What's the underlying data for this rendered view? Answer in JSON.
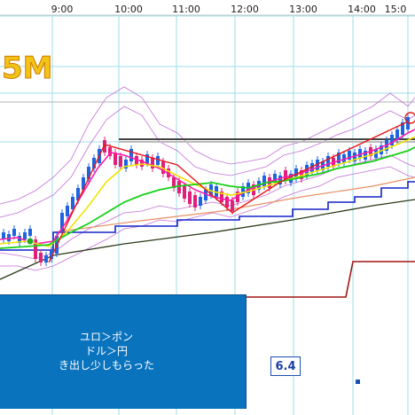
{
  "chart": {
    "timeframe_badge": "5M",
    "time_labels": [
      "9:00",
      "10:00",
      "11:00",
      "12:00",
      "13:00",
      "14:00",
      "15:0"
    ],
    "value_tag": "6.4",
    "colors": {
      "grid": "#9edfe6",
      "candle_up": "#1e64e0",
      "candle_down": "#e0207a",
      "zigzag": "#e8181a",
      "ma_fast": "#ff1aa8",
      "ma_mid": "#f0e400",
      "cloud_line": "#18d018",
      "step_blue": "#1424c8",
      "trend_black": "#2a3a1a",
      "trend_orange": "#e89064",
      "bollinger": "#c470d8",
      "step_red": "#a01414"
    }
  },
  "note": {
    "line1": "ユロ＞ポン",
    "line2": "ドル＞円",
    "line3": "き出し少しもらった"
  }
}
